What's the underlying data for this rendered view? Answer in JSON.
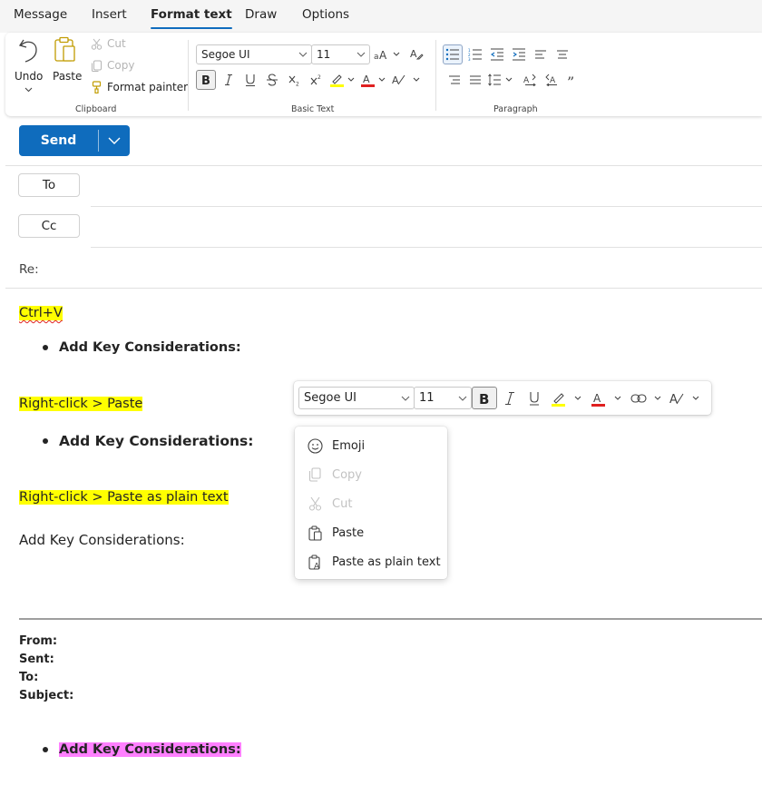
{
  "tabs": [
    {
      "label": "Message"
    },
    {
      "label": "Insert"
    },
    {
      "label": "Format text"
    },
    {
      "label": "Draw"
    },
    {
      "label": "Options"
    }
  ],
  "active_tab": "Format text",
  "ribbon": {
    "clipboard": {
      "group_label": "Clipboard",
      "undo_label": "Undo",
      "paste_label": "Paste",
      "cut_label": "Cut",
      "copy_label": "Copy",
      "format_painter_label": "Format painter"
    },
    "basic_text": {
      "group_label": "Basic Text",
      "font_name": "Segoe UI",
      "font_size": "11"
    },
    "paragraph": {
      "group_label": "Paragraph"
    }
  },
  "compose": {
    "send_label": "Send",
    "to_label": "To",
    "cc_label": "Cc",
    "subject_label": "Re:"
  },
  "body": {
    "line1": "Ctrl+V",
    "bullet1": "Add Key Considerations:",
    "line2": "Right-click > Paste",
    "bullet2": "Add Key Considerations:",
    "line3": "Right-click > Paste as plain text",
    "plain_text": "Add Key Considerations:",
    "quoted": {
      "from_label": "From:",
      "sent_label": "Sent:",
      "to_label": "To:",
      "subject_label": "Subject:",
      "bullet": "Add Key Considerations:"
    }
  },
  "floating_toolbar": {
    "font_name": "Segoe UI",
    "font_size": "11"
  },
  "context_menu": {
    "items": [
      {
        "label": "Emoji",
        "enabled": true,
        "icon": "emoji-icon"
      },
      {
        "label": "Copy",
        "enabled": false,
        "icon": "copy-icon"
      },
      {
        "label": "Cut",
        "enabled": false,
        "icon": "cut-icon"
      },
      {
        "label": "Paste",
        "enabled": true,
        "icon": "paste-icon"
      },
      {
        "label": "Paste as plain text",
        "enabled": true,
        "icon": "paste-plain-text-icon"
      }
    ]
  },
  "colors": {
    "accent": "#0f6cbd",
    "highlight_yellow": "#ffff00",
    "highlight_pink": "#ff80ff",
    "font_color_red": "#e02020"
  }
}
